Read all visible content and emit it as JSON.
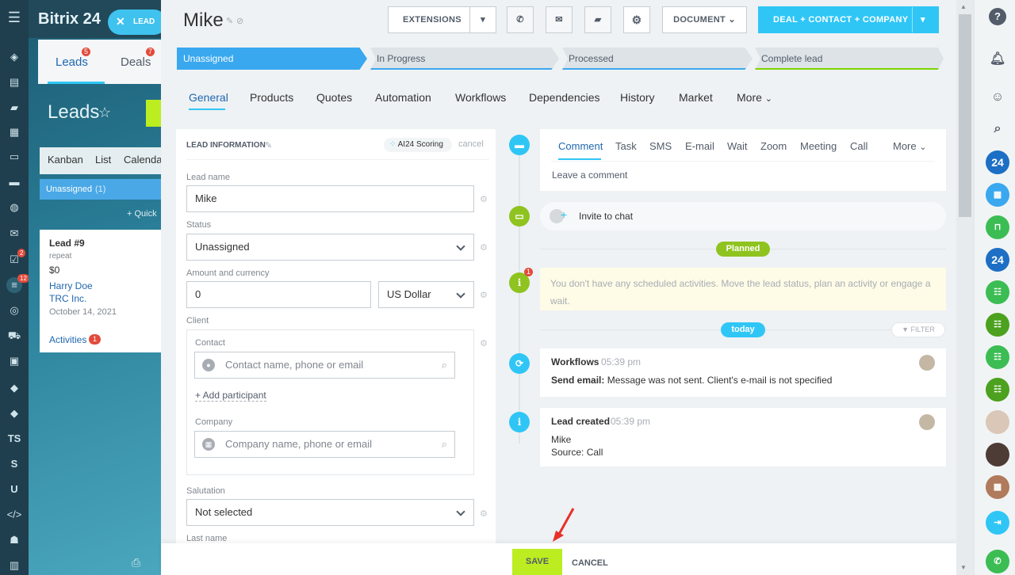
{
  "background": {
    "app_name": "Bitrix 24",
    "lead_tag": "LEAD",
    "tabs": [
      {
        "label": "Leads",
        "badge": "5"
      },
      {
        "label": "Deals",
        "badge": "7"
      }
    ],
    "page_title": "Leads",
    "views": [
      "Kanban",
      "List",
      "Calenda"
    ],
    "column_title": "Unassigned",
    "column_count": "(1)",
    "quick_label": "+ Quick",
    "card": {
      "title": "Lead #9",
      "tag": "repeat",
      "amount": "$0",
      "contact": "Harry Doe",
      "company": "TRC Inc.",
      "date": "October 14, 2021",
      "activities_label": "Activities",
      "activities_count": "1"
    },
    "nav_badges": [
      "2",
      "12"
    ],
    "nav_texts": [
      "TS",
      "S",
      "U"
    ]
  },
  "header": {
    "title": "Mike",
    "extensions_label": "EXTENSIONS",
    "document_label": "DOCUMENT",
    "primary_label": "DEAL + CONTACT + COMPANY"
  },
  "stages": [
    "Unassigned",
    "In Progress",
    "Processed",
    "Complete lead"
  ],
  "colors": {
    "accent": "#2fc6f6",
    "stage_active": "#39a8ef",
    "save": "#bbed21",
    "green": "#7cb342"
  },
  "tabs": [
    "General",
    "Products",
    "Quotes",
    "Automation",
    "Workflows",
    "Dependencies",
    "History",
    "Market",
    "More"
  ],
  "lead_info": {
    "title": "LEAD INFORMATION",
    "scoring_label": "AI24 Scoring",
    "cancel_label": "cancel",
    "lead_name_label": "Lead name",
    "lead_name_value": "Mike",
    "status_label": "Status",
    "status_value": "Unassigned",
    "amount_label": "Amount and currency",
    "amount_value": "0",
    "currency_value": "US Dollar",
    "client_label": "Client",
    "contact_label": "Contact",
    "contact_placeholder": "Contact name, phone or email",
    "add_participant": "+ Add participant",
    "company_label": "Company",
    "company_placeholder": "Company name, phone or email",
    "salutation_label": "Salutation",
    "salutation_value": "Not selected",
    "last_name_label": "Last name"
  },
  "activity": {
    "tabs": [
      "Comment",
      "Task",
      "SMS",
      "E-mail",
      "Wait",
      "Zoom",
      "Meeting",
      "Call",
      "More"
    ],
    "comment_placeholder": "Leave a comment",
    "invite_label": "Invite to chat",
    "planned_label": "Planned",
    "planned_badge": "1",
    "planned_text": "You don't have any scheduled activities. Move the lead status, plan an activity or engage a wait.",
    "today_label": "today",
    "filter_label": "FILTER",
    "items": [
      {
        "title": "Workflows",
        "time": "05:39 pm",
        "line1_bold": "Send email:",
        "line1": " Message was not sent. Client's e-mail is not specified",
        "line2": ""
      },
      {
        "title": "Lead created",
        "time": "05:39 pm",
        "line1_bold": "",
        "line1": "Mike",
        "line2": "Source: Call"
      }
    ]
  },
  "footer": {
    "save_label": "SAVE",
    "cancel_label": "CANCEL"
  },
  "right_rail": {
    "badges": [
      "24",
      "24"
    ]
  }
}
